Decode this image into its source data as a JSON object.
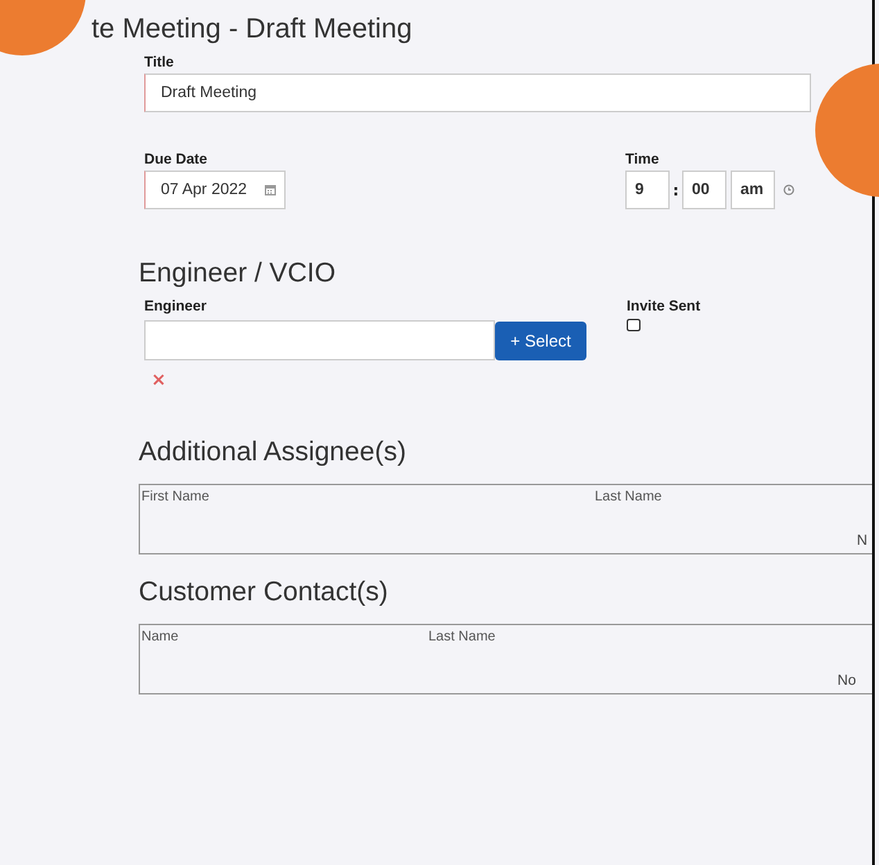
{
  "page_title": "te Meeting - Draft Meeting",
  "callouts": {
    "top_left": true,
    "right": true
  },
  "title_field": {
    "label": "Title",
    "value": "Draft Meeting"
  },
  "due_date": {
    "label": "Due Date",
    "value": "07 Apr 2022"
  },
  "time": {
    "label": "Time",
    "hour": "9",
    "separator": ":",
    "minute": "00",
    "period": "am"
  },
  "engineer_section": {
    "heading": "Engineer / VCIO",
    "engineer_label": "Engineer",
    "select_button": "+ Select",
    "clear": "×",
    "invite_label": "Invite Sent",
    "invite_checked": false
  },
  "tables": [
    {
      "heading": "Additional Assignee(s)",
      "columns": [
        "First Name",
        "Last Name"
      ],
      "empty_message": "N"
    },
    {
      "heading": "Customer Contact(s)",
      "columns": [
        "Name",
        "Last Name"
      ],
      "empty_message": "No"
    }
  ]
}
